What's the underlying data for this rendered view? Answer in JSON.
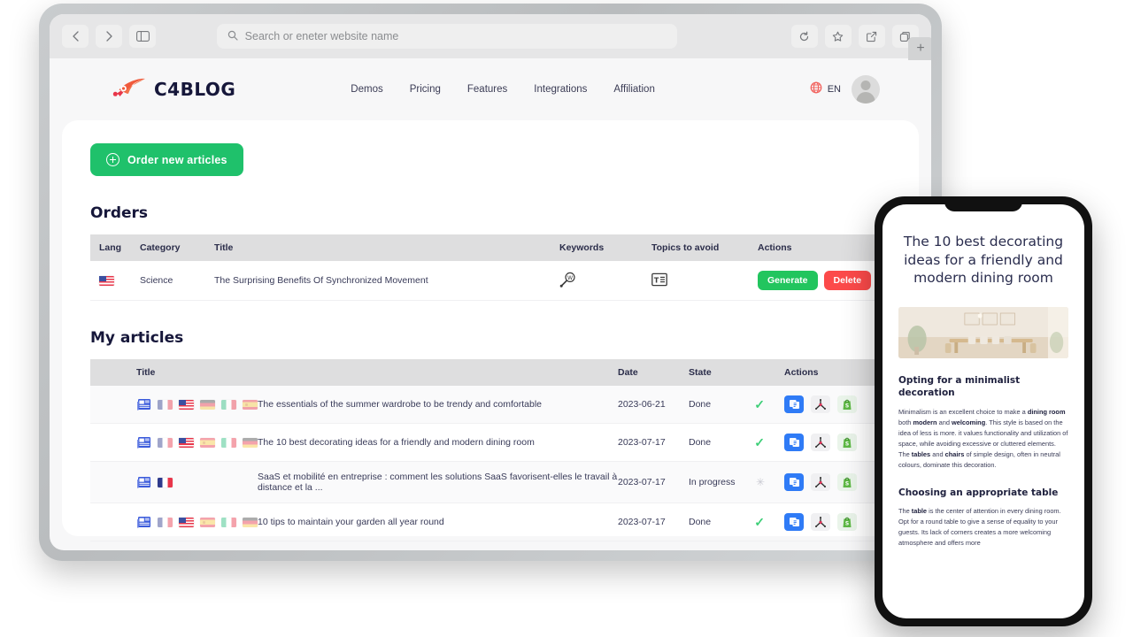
{
  "browser": {
    "back_icon": "chevron-left-icon",
    "forward_icon": "chevron-right-icon",
    "sidebar_icon": "sidebar-toggle-icon",
    "search_placeholder": "Search or eneter website name",
    "search_value": "",
    "reload_icon": "reload-icon",
    "bookmark_icon": "star-icon",
    "share_icon": "share-icon",
    "tabs_icon": "tabs-icon",
    "new_tab_label": "+"
  },
  "site_header": {
    "logo_text": "C4BLOG",
    "logo_icon": "pen-nib-icon",
    "nav": [
      {
        "label": "Demos"
      },
      {
        "label": "Pricing"
      },
      {
        "label": "Features"
      },
      {
        "label": "Integrations"
      },
      {
        "label": "Affiliation"
      }
    ],
    "language": {
      "icon": "globe-icon",
      "code": "EN"
    },
    "avatar": "user-avatar"
  },
  "app": {
    "order_button": {
      "label": "Order new articles",
      "icon": "plus-circle-icon",
      "color": "#1fc16b"
    },
    "orders": {
      "title": "Orders",
      "columns": [
        "Lang",
        "Category",
        "Title",
        "Keywords",
        "Topics to avoid",
        "Actions"
      ],
      "rows": [
        {
          "lang": "us",
          "category": "Science",
          "title": "The Surprising Benefits Of Synchronized Movement",
          "keywords_icon": "magnifier-w-icon",
          "avoid_icon": "text-article-icon",
          "actions": [
            {
              "label": "Generate",
              "color": "#22c55e"
            },
            {
              "label": "Delete",
              "color": "#fc4a4a"
            }
          ]
        }
      ]
    },
    "articles": {
      "title": "My articles",
      "columns": [
        "Title",
        "Date",
        "State",
        "Actions"
      ],
      "rows": [
        {
          "flags": [
            "fr-faded",
            "us",
            "de-faded",
            "it-faded",
            "es-faded"
          ],
          "title": "The essentials of the summer wardrobe to be trendy and comfortable",
          "date": "2023-06-21",
          "state": "Done",
          "state_icon": "check-icon",
          "actions": [
            "duplicate-icon",
            "wordpress-icon",
            "shopify-icon"
          ]
        },
        {
          "flags": [
            "fr-faded",
            "us",
            "es-faded",
            "it-faded",
            "de-faded"
          ],
          "title": "The 10 best decorating ideas for a friendly and modern dining room",
          "date": "2023-07-17",
          "state": "Done",
          "state_icon": "check-icon",
          "actions": [
            "duplicate-icon",
            "wordpress-icon",
            "shopify-icon"
          ]
        },
        {
          "flags": [
            "fr"
          ],
          "title": "SaaS et mobilité en entreprise : comment les solutions SaaS favorisent-elles le travail à distance et la ...",
          "date": "2023-07-17",
          "state": "In progress",
          "state_icon": "spinner-icon",
          "actions": [
            "duplicate-icon",
            "wordpress-icon",
            "shopify-icon"
          ]
        },
        {
          "flags": [
            "fr-faded",
            "us",
            "es-faded",
            "it-faded",
            "de-faded"
          ],
          "title": "10 tips to maintain your garden all year round",
          "date": "2023-07-17",
          "state": "Done",
          "state_icon": "check-icon",
          "actions": [
            "duplicate-icon",
            "wordpress-icon",
            "shopify-icon"
          ]
        }
      ]
    }
  },
  "phone": {
    "article_title": "The 10 best decorating ideas for a friendly and modern dining room",
    "hero_image": "dining-room-photo",
    "sections": [
      {
        "heading": "Opting for a minimalist decoration",
        "body_html": "Minimalism is an excellent choice to make a <b>dining room</b> both <b>modern</b> and <b>welcoming</b>. This style is based on the idea of less is more. it values functionality and utilization of space, while avoiding excessive or cluttered elements. The <b>tables</b> and <b>chairs</b> of simple design, often in neutral colours, dominate this decoration."
      },
      {
        "heading": "Choosing an appropriate table",
        "body_html": "The <b>table</b> is the center of attention in every dining room. Opt for a round table to give a sense of equality to your guests. Its lack of corners creates a more welcoming atmosphere and offers more"
      }
    ]
  }
}
